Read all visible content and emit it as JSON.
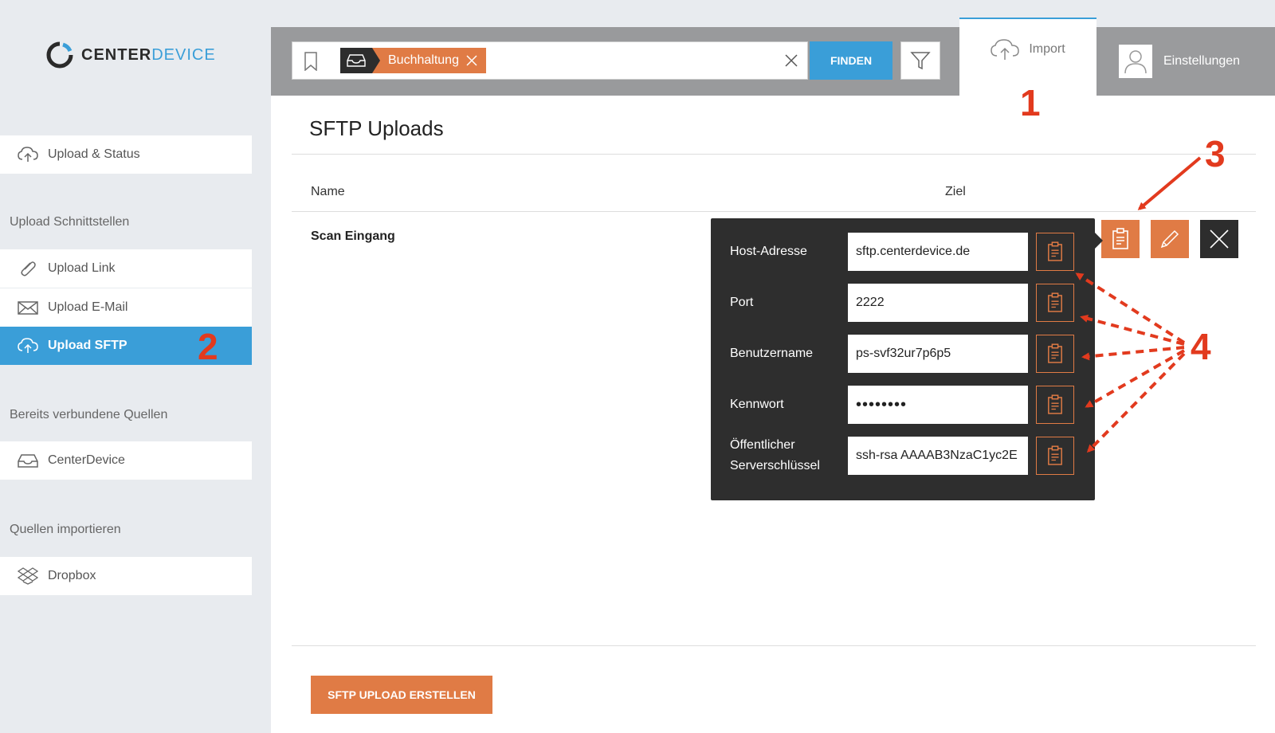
{
  "brand": {
    "name_part1": "CENTER",
    "name_part2": "DEVICE"
  },
  "sidebar": {
    "upload_status": "Upload & Status",
    "heading_interfaces": "Upload Schnittstellen",
    "upload_link": "Upload Link",
    "upload_email": "Upload E-Mail",
    "upload_sftp": "Upload SFTP",
    "heading_connected": "Bereits verbundene Quellen",
    "centerdevice": "CenterDevice",
    "heading_import": "Quellen importieren",
    "dropbox": "Dropbox"
  },
  "search": {
    "tag": "Buchhaltung",
    "button": "FINDEN"
  },
  "tabs": {
    "import": "Import",
    "settings": "Einstellungen"
  },
  "main": {
    "title": "SFTP Uploads",
    "col_name": "Name",
    "col_target": "Ziel",
    "row_name": "Scan Eingang",
    "create_button": "SFTP UPLOAD ERSTELLEN"
  },
  "popover": {
    "host_label": "Host-Adresse",
    "host_value": "sftp.centerdevice.de",
    "port_label": "Port",
    "port_value": "2222",
    "user_label": "Benutzername",
    "user_value": "ps-svf32ur7p6p5",
    "pass_label": "Kennwort",
    "pass_value": "••••••••",
    "key_label_1": "Öffentlicher",
    "key_label_2": "Serverschlüssel",
    "key_value": "ssh-rsa AAAAB3NzaC1yc2E"
  },
  "annotations": {
    "a1": "1",
    "a2": "2",
    "a3": "3",
    "a4": "4"
  },
  "colors": {
    "accent_blue": "#3a9ed8",
    "accent_orange": "#e07b45",
    "annotation_red": "#e23a1e"
  }
}
